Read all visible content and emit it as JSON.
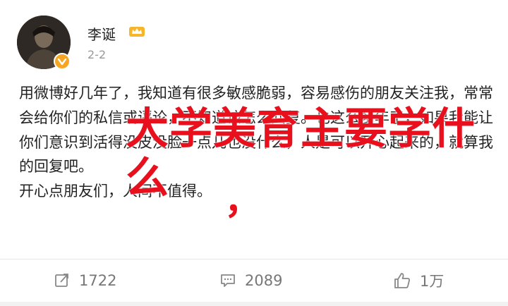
{
  "post": {
    "author": "李诞",
    "time": "2-2",
    "body": "用微博好几年了，我知道有很多敏感脆弱，容易感伤的朋友关注我，常常会给你们的私信或评论，不知道该怎么回复。也这么多年了，如果我能让你们意识到活得没皮没脸一点儿也没什么，人是可以开心起来的，就算我的回复吧。\n开心点朋友们，人间不值得。"
  },
  "overlay": {
    "title": "大学美育主要学什么",
    "mark": "，",
    "color": "#e8101d"
  },
  "actions": {
    "repost_count": "1722",
    "comment_count": "2089",
    "like_count": "1万"
  },
  "icons": {
    "repost": "repost-icon",
    "comment": "comment-icon",
    "like": "thumbs-up-icon",
    "crown": "crown-badge-icon",
    "vip": "vip-badge-icon"
  }
}
